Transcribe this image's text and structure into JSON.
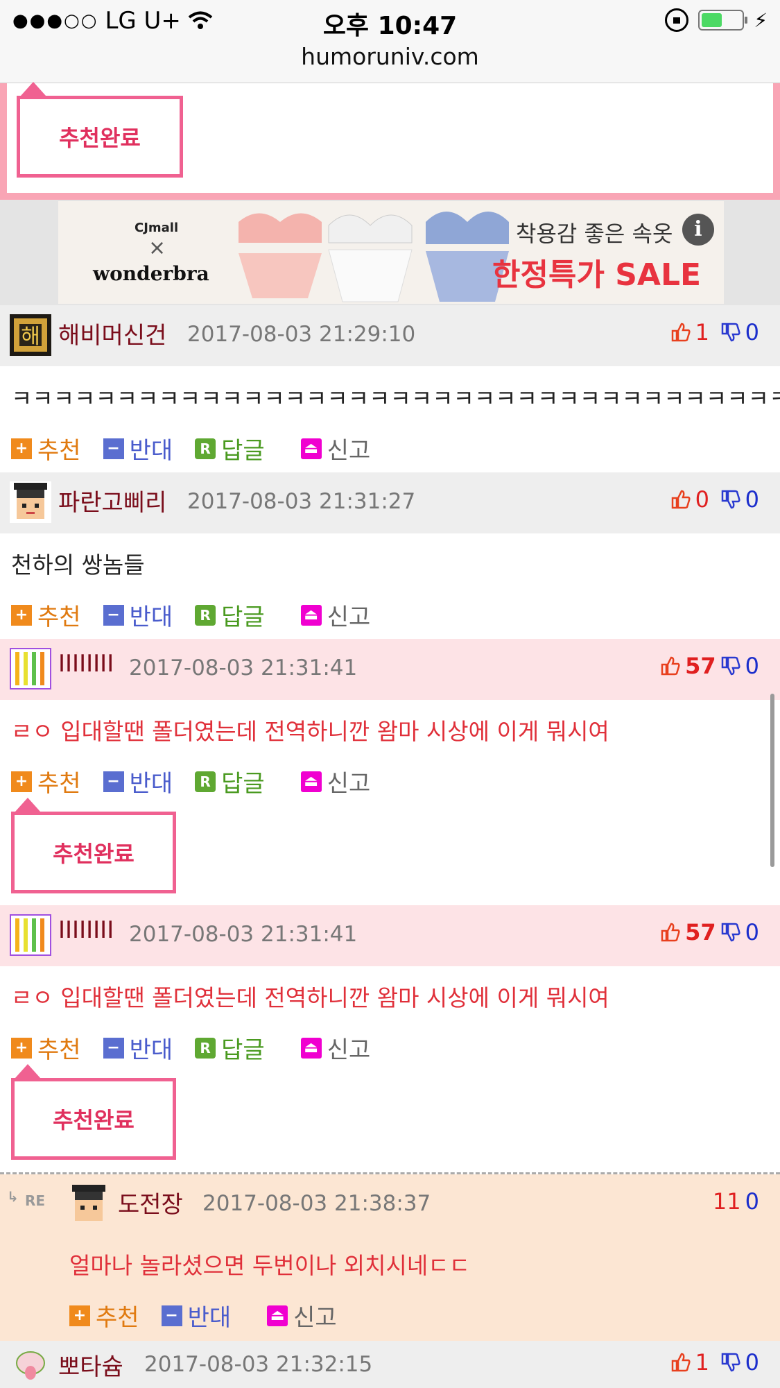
{
  "status_bar": {
    "carrier": "LG U+",
    "time": "오후 10:47",
    "url": "humoruniv.com"
  },
  "recommend_done_label": "추천완료",
  "ad": {
    "brand1": "CJmall",
    "brand_x": "×",
    "brand2": "wonderbra",
    "copy": "착용감 좋은 속옷",
    "sale": "한정특가 SALE",
    "info": "i"
  },
  "actions": {
    "recommend": "추천",
    "oppose": "반대",
    "reply": "답글",
    "report": "신고",
    "reply_icon": "R"
  },
  "comments": [
    {
      "nick": "해비머신건",
      "date": "2017-08-03 21:29:10",
      "up": "1",
      "down": "0",
      "text": "ㅋㅋㅋㅋㅋㅋㅋㅋㅋㅋㅋㅋㅋㅋㅋㅋㅋㅋㅋㅋㅋㅋㅋㅋㅋㅋㅋㅋㅋㅋㅋㅋㅋㅋㅋㅋㅋ"
    },
    {
      "nick": "파란고삐리",
      "date": "2017-08-03 21:31:27",
      "up": "0",
      "down": "0",
      "text": "천하의 쌍놈들"
    },
    {
      "nick": "IIIIIIII",
      "date": "2017-08-03 21:31:41",
      "up": "57",
      "down": "0",
      "text": "ㄹㅇ 입대할땐 폴더였는데 전역하니깐 왐마 시상에 이게 뭐시여"
    },
    {
      "nick": "IIIIIIII",
      "date": "2017-08-03 21:31:41",
      "up": "57",
      "down": "0",
      "text": "ㄹㅇ 입대할땐 폴더였는데 전역하니깐 왐마 시상에 이게 뭐시여"
    },
    {
      "nick": "도전장",
      "date": "2017-08-03 21:38:37",
      "up": "11",
      "down": "0",
      "text": "얼마나 놀라셨으면 두번이나 외치시네ㄷㄷ",
      "re_mark": "RE"
    },
    {
      "nick": "뽀타슘",
      "date": "2017-08-03 21:32:15",
      "up": "1",
      "down": "0"
    }
  ],
  "colors": {
    "accent_pink": "#f06191",
    "up_red": "#e02020",
    "down_blue": "#1b2ecc"
  }
}
